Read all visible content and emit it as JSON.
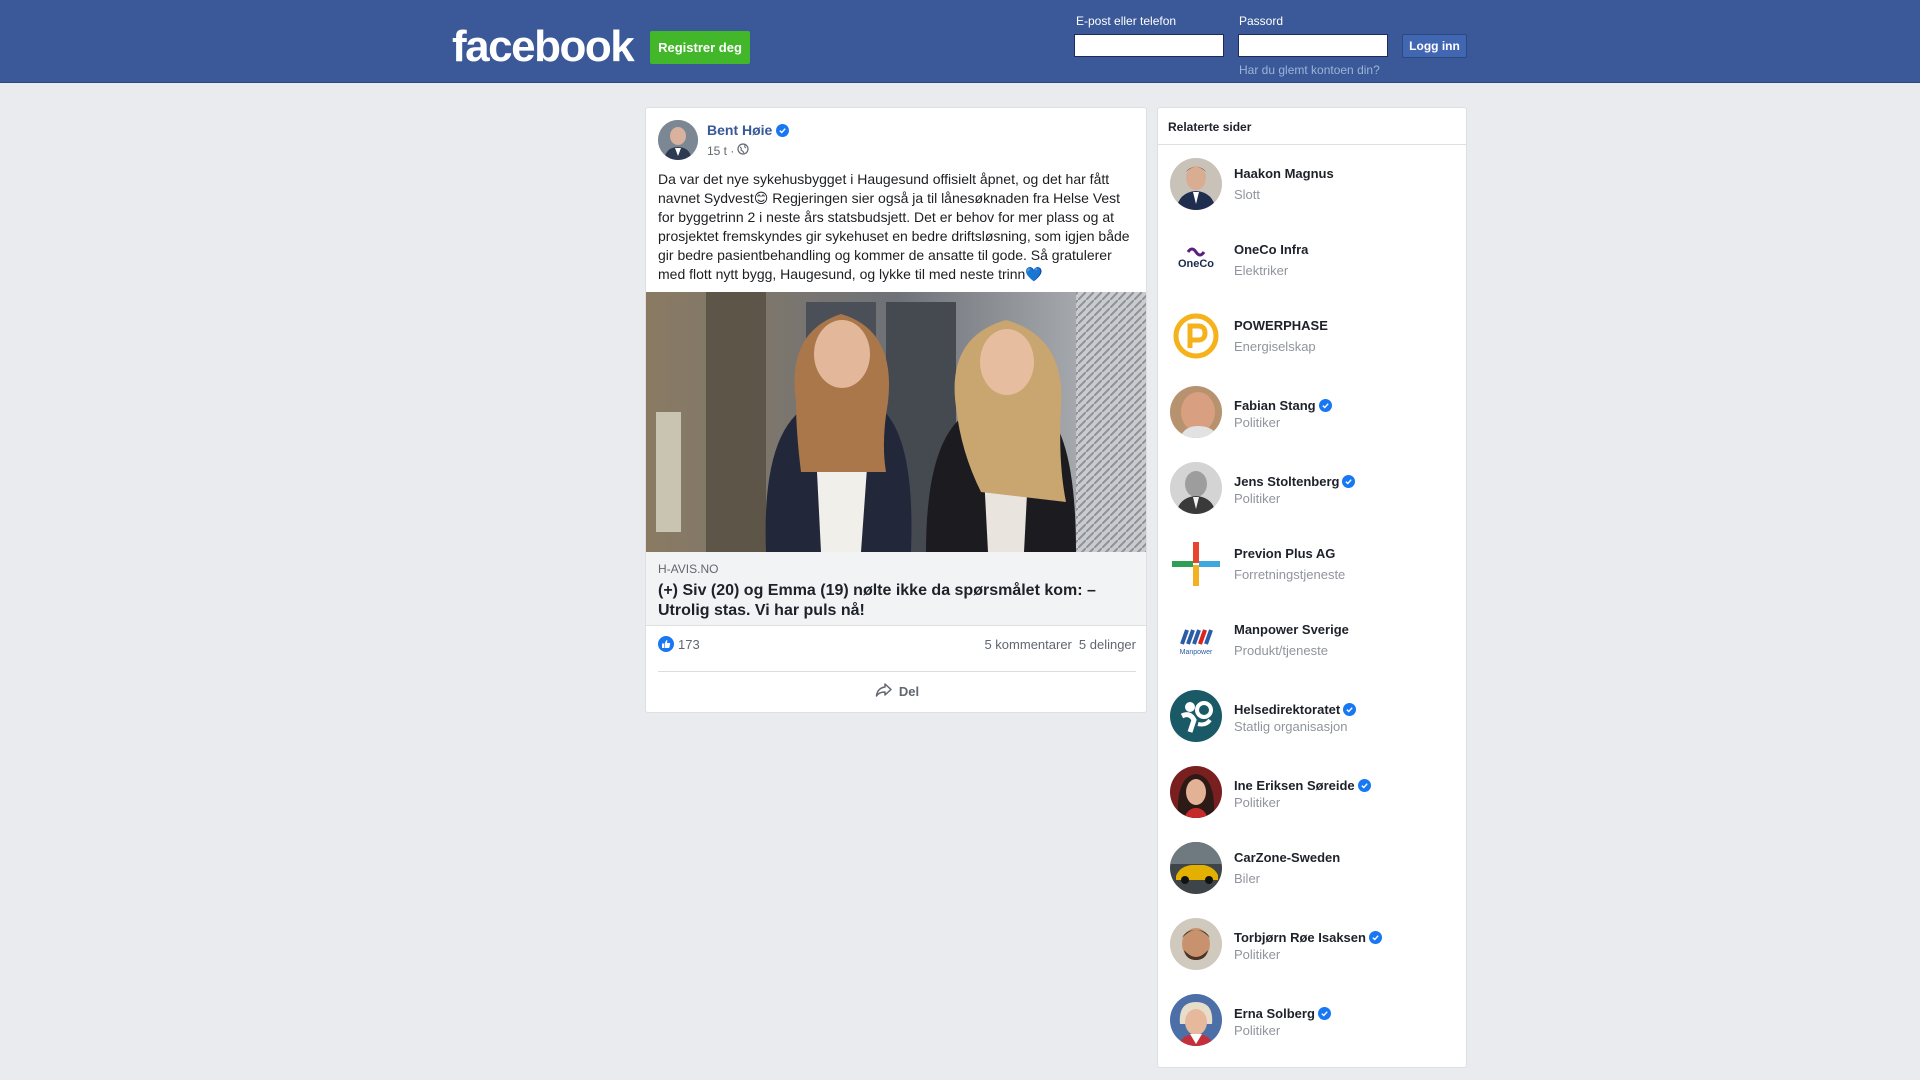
{
  "header": {
    "logo": "facebook",
    "register_label": "Registrer deg",
    "email_label": "E-post eller telefon",
    "password_label": "Passord",
    "email_value": "",
    "password_value": "",
    "login_label": "Logg inn",
    "forgot_label": "Har du glemt kontoen din?"
  },
  "post": {
    "author": "Bent Høie",
    "verified": true,
    "time": "15 t ·",
    "privacy_icon": "globe-icon",
    "text": "Da var det nye sykehusbygget i Haugesund offisielt åpnet, og det har fått navnet Sydvest😊 Regjeringen sier også ja til lånesøknaden fra Helse Vest for byggetrinn 2 i neste års statsbudsjett. Det er behov for mer plass og at prosjektet fremskyndes gir sykehuset en bedre driftsløsning, som igjen både gir bedre pasientbehandling og kommer de ansatte til gode. Så gratulerer med flott nytt bygg, Haugesund, og lykke til med neste trinn💙",
    "link_domain": "H-AVIS.NO",
    "link_title": "(+) Siv (20) og Emma (19) nølte ikke da spørsmålet kom: – Utrolig stas. Vi har puls nå!",
    "likes": "173",
    "comments": "5 kommentarer",
    "shares": "5 delinger",
    "share_label": "Del"
  },
  "related": {
    "title": "Relaterte sider",
    "items": [
      {
        "name": "Haakon Magnus",
        "category": "Slott",
        "verified": false
      },
      {
        "name": "OneCo Infra",
        "category": "Elektriker",
        "verified": false
      },
      {
        "name": "POWERPHASE",
        "category": "Energiselskap",
        "verified": false
      },
      {
        "name": "Fabian Stang",
        "category": "Politiker",
        "verified": true
      },
      {
        "name": "Jens Stoltenberg",
        "category": "Politiker",
        "verified": true
      },
      {
        "name": "Previon Plus AG",
        "category": "Forretningstjeneste",
        "verified": false
      },
      {
        "name": "Manpower Sverige",
        "category": "Produkt/tjeneste",
        "verified": false
      },
      {
        "name": "Helsedirektoratet",
        "category": "Statlig organisasjon",
        "verified": true
      },
      {
        "name": "Ine Eriksen Søreide",
        "category": "Politiker",
        "verified": true
      },
      {
        "name": "CarZone-Sweden",
        "category": "Biler",
        "verified": false
      },
      {
        "name": "Torbjørn Røe Isaksen",
        "category": "Politiker",
        "verified": true
      },
      {
        "name": "Erna Solberg",
        "category": "Politiker",
        "verified": true
      }
    ],
    "logo_text": {
      "oneco": "OneCo",
      "manpower": "Manpower"
    }
  },
  "colors": {
    "header_bg": "#3b5998",
    "register_green": "#42b72a",
    "link_blue": "#385898",
    "verified_blue": "#1877f2"
  }
}
